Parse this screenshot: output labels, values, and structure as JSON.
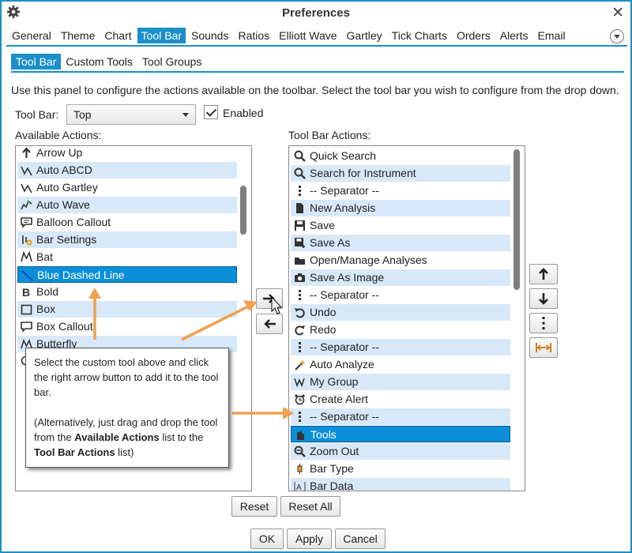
{
  "window": {
    "title": "Preferences"
  },
  "tabs": [
    "General",
    "Theme",
    "Chart",
    "Tool Bar",
    "Sounds",
    "Ratios",
    "Elliott Wave",
    "Gartley",
    "Tick Charts",
    "Orders",
    "Alerts",
    "Email"
  ],
  "active_tab": "Tool Bar",
  "subtabs": [
    "Tool Bar",
    "Custom Tools",
    "Tool Groups"
  ],
  "description": "Use this panel to configure the actions available on the toolbar.  Select the tool bar you wish to configure from the drop down.",
  "toolbar_select": {
    "label": "Tool Bar:",
    "value": "Top"
  },
  "enabled": {
    "label": "Enabled",
    "checked": true
  },
  "available": {
    "label": "Available Actions:",
    "items": [
      "Arrow Up",
      "Auto ABCD",
      "Auto Gartley",
      "Auto Wave",
      "Balloon Callout",
      "Bar Settings",
      "Bat",
      "Blue Dashed Line",
      "Bold",
      "Box",
      "Box Callout",
      "Butterfly",
      "Circle"
    ],
    "selected": "Blue Dashed Line"
  },
  "toolbar_actions": {
    "label": "Tool Bar Actions:",
    "items": [
      "Quick Search",
      "Search for Instrument",
      "-- Separator --",
      "New Analysis",
      "Save",
      "Save As",
      "Open/Manage Analyses",
      "Save As Image",
      "-- Separator --",
      "Undo",
      "Redo",
      "-- Separator --",
      "Auto Analyze",
      "My Group",
      "Create Alert",
      "-- Separator --",
      "Tools",
      "Zoom Out",
      "Bar Type",
      "Bar Data"
    ],
    "selected": "Tools"
  },
  "buttons": {
    "reset": "Reset",
    "reset_all": "Reset All",
    "ok": "OK",
    "apply": "Apply",
    "cancel": "Cancel"
  },
  "tooltip": {
    "line1": "Select the custom tool above and click the right arrow button to add it to the tool bar.",
    "line2_pre": "(Alternatively, just drag and drop the tool from the ",
    "line2_b1": "Available Actions",
    "line2_mid": " list to the ",
    "line2_b2": "Tool Bar Actions",
    "line2_post": " list)"
  },
  "colors": {
    "accent": "#1a8fc9",
    "row_alt": "#d7e9f9",
    "selection": "#0c8fd9",
    "annotation_arrow": "#f0a050"
  }
}
